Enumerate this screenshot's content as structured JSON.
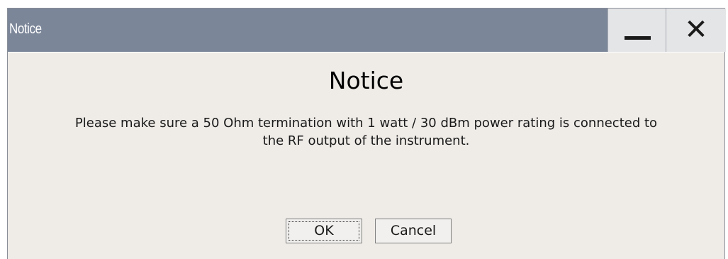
{
  "window": {
    "title": "Notice",
    "minimize_icon": "minimize-icon",
    "close_icon": "close-icon",
    "close_glyph": "✕"
  },
  "dialog": {
    "heading": "Notice",
    "message_line1": "Please make sure a 50 Ohm termination with 1 watt / 30 dBm power rating is connected to",
    "message_line2": "the RF output of the instrument."
  },
  "buttons": {
    "ok_label": "OK",
    "cancel_label": "Cancel"
  },
  "colors": {
    "titlebar": "#7b8699",
    "dialog_background": "#efece8",
    "window_button": "#e4e5e7"
  }
}
